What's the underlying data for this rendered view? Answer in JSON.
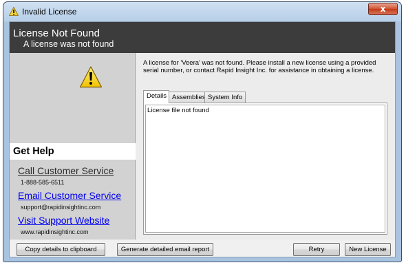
{
  "window": {
    "title": "Invalid License",
    "close_label": "x"
  },
  "header": {
    "title": "License Not Found",
    "subtitle": "A license was not found"
  },
  "message": "A license for 'Veera' was not found. Please install a new license using a provided serial number, or contact Rapid Insight Inc. for assistance in obtaining a license.",
  "help": {
    "heading": "Get Help",
    "items": [
      {
        "label": "Call Customer Service",
        "detail": "1-888-585-6511"
      },
      {
        "label": "Email Customer Service",
        "detail": "support@rapidinsightinc.com"
      },
      {
        "label": "Visit Support Website",
        "detail": "www.rapidinsightinc.com"
      }
    ]
  },
  "tabs": [
    {
      "label": "Details",
      "active": true
    },
    {
      "label": "Assemblies",
      "active": false
    },
    {
      "label": "System Info",
      "active": false
    }
  ],
  "details_text": "License file not found",
  "buttons": {
    "copy": "Copy details to clipboard",
    "email_report": "Generate detailed email report",
    "retry": "Retry",
    "new_license": "New License"
  },
  "icons": {
    "title": "warning-icon",
    "main": "warning-icon"
  }
}
